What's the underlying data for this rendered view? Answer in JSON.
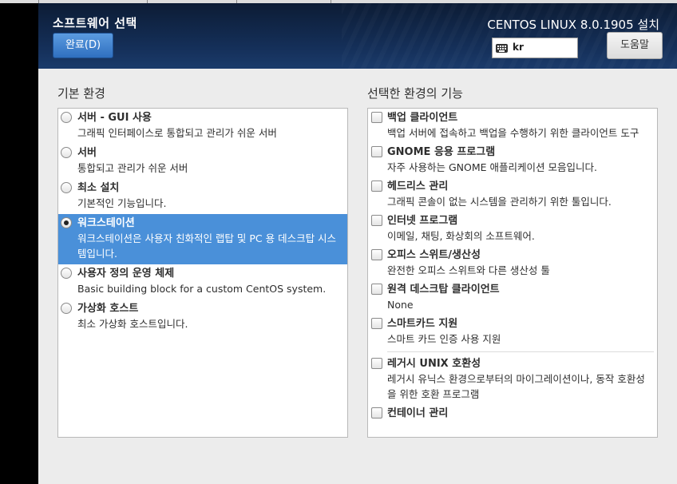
{
  "header": {
    "title": "소프트웨어 선택",
    "done_label": "완료(D)",
    "installer_title": "CENTOS LINUX 8.0.1905 설치",
    "keyboard_layout": "kr",
    "help_label": "도움말"
  },
  "environment": {
    "section_title": "기본 환경",
    "items": [
      {
        "title": "서버 - GUI 사용",
        "desc": "그래픽 인터페이스로 통합되고 관리가 쉬운 서버",
        "selected": false
      },
      {
        "title": "서버",
        "desc": "통합되고 관리가 쉬운 서버",
        "selected": false
      },
      {
        "title": "최소 설치",
        "desc": "기본적인 기능입니다.",
        "selected": false
      },
      {
        "title": "워크스테이션",
        "desc": "워크스테이션은 사용자 친화적인 랩탑 및 PC 용 데스크탑 시스템입니다.",
        "selected": true
      },
      {
        "title": "사용자 정의 운영 체제",
        "desc": "Basic building block for a custom CentOS system.",
        "selected": false
      },
      {
        "title": "가상화 호스트",
        "desc": "최소 가상화 호스트입니다.",
        "selected": false
      }
    ]
  },
  "addons": {
    "section_title": "선택한 환경의 기능",
    "items": [
      {
        "title": "백업 클라이언트",
        "desc": "백업 서버에 접속하고 백업을 수행하기 위한 클라이언트 도구",
        "checked": false
      },
      {
        "title": "GNOME 응용 프로그램",
        "desc": "자주 사용하는 GNOME 애플리케이션 모음입니다.",
        "checked": false
      },
      {
        "title": "헤드리스 관리",
        "desc": "그래픽 콘솔이 없는 시스템을 관리하기 위한 툴입니다.",
        "checked": false
      },
      {
        "title": "인터넷 프로그램",
        "desc": "이메일, 채팅, 화상회의 소프트웨어.",
        "checked": false
      },
      {
        "title": "오피스 스위트/생산성",
        "desc": "완전한 오피스 스위트와 다른 생산성 툴",
        "checked": false
      },
      {
        "title": "원격 데스크탑 클라이언트",
        "desc": "None",
        "checked": false
      },
      {
        "title": "스마트카드 지원",
        "desc": "스마트 카드 인증 사용 지원",
        "checked": false
      },
      {
        "title": "레거시 UNIX 호환성",
        "desc": "레거시 유닉스 환경으로부터의 마이그레이션이나, 동작 호환성을 위한 호환 프로그램",
        "checked": false
      },
      {
        "title": "컨테이너 관리",
        "desc": "",
        "checked": false
      }
    ]
  }
}
